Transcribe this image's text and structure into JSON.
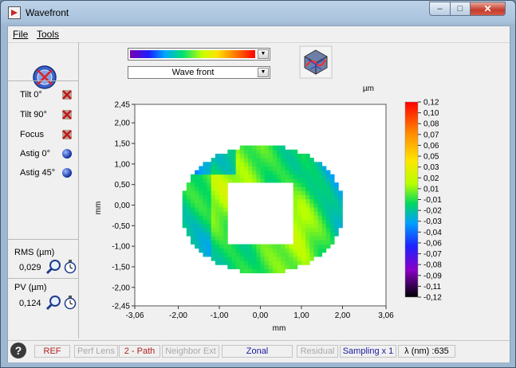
{
  "window": {
    "title": "Wavefront"
  },
  "caption_buttons": {
    "minimize": "–",
    "maximize": "□",
    "close": "✕"
  },
  "menu": {
    "file": "File",
    "tools": "Tools"
  },
  "left_panel": {
    "zernike": [
      {
        "label": "Tilt 0°",
        "icon": "disabled-x-icon"
      },
      {
        "label": "Tilt 90°",
        "icon": "disabled-x-icon"
      },
      {
        "label": "Focus",
        "icon": "disabled-x-icon"
      },
      {
        "label": "Astig 0°",
        "icon": "blue-sphere-icon"
      },
      {
        "label": "Astig 45°",
        "icon": "blue-sphere-icon"
      }
    ],
    "rms_label": "RMS (µm)",
    "rms_value": "0,029",
    "pv_label": "PV (µm)",
    "pv_value": "0,124"
  },
  "controls": {
    "palette_value": "rainbow",
    "display_mode": "Wave front"
  },
  "chart_data": {
    "type": "heatmap",
    "title": "",
    "xlabel": "mm",
    "ylabel": "mm",
    "xlim": [
      -3.06,
      3.06
    ],
    "ylim": [
      -2.45,
      2.45
    ],
    "x_ticks": [
      "-3,06",
      "-2,00",
      "-1,00",
      "0,00",
      "1,00",
      "2,00",
      "3,06"
    ],
    "y_ticks": [
      "2,45",
      "2,00",
      "1,50",
      "1,00",
      "0,50",
      "0,00",
      "-0,50",
      "-1,00",
      "-1,50",
      "-2,00",
      "-2,45"
    ],
    "colorbar_unit": "µm",
    "colorbar_range": [
      -0.12,
      0.12
    ],
    "colorbar_ticks": [
      "0,12",
      "0,10",
      "0,08",
      "0,07",
      "0,06",
      "0,05",
      "0,03",
      "0,02",
      "0,01",
      "-0,01",
      "-0,02",
      "-0,03",
      "-0,04",
      "-0,06",
      "-0,07",
      "-0,08",
      "-0,09",
      "-0,11",
      "-0,12"
    ],
    "pupil": {
      "outer_radius_mm": 1.75,
      "inner_radius_mm": 0.75,
      "center": [
        0.05,
        -0.1
      ]
    }
  },
  "statusbar": {
    "help": "?",
    "ref": "REF",
    "perf_lens": "Perf Lens",
    "path": "2 - Path",
    "neighbor": "Neighbor Ext",
    "mode": "Zonal",
    "residual": "Residual",
    "sampling": "Sampling x 1",
    "lambda": "λ (nm) :635"
  },
  "colors": {
    "ref": "#b22222",
    "path": "#b22222",
    "zonal": "#1a1aa0",
    "sampling": "#1a1aa0",
    "disabled": "#a9a9a9"
  }
}
